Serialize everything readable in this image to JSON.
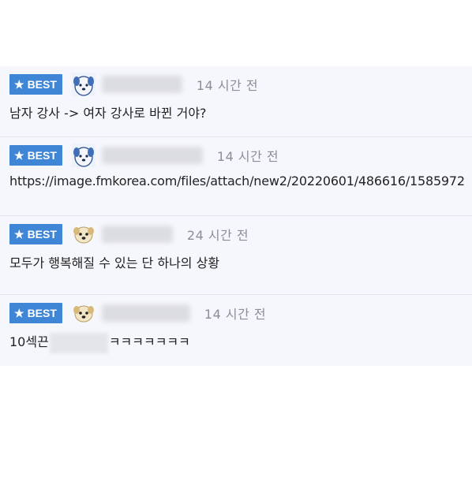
{
  "badge_label": "BEST",
  "comments": [
    {
      "avatar": "dog-white-icon",
      "time": "14 시간 전",
      "text": "남자 강사 -> 여자 강사로 바뀐 거야?"
    },
    {
      "avatar": "dog-white-icon",
      "time": "14 시간 전",
      "text": "https://image.fmkorea.com/files/attach/new2/20220601/486616/1585972"
    },
    {
      "avatar": "puppy-icon",
      "time": "24 시간 전",
      "text": "모두가 행복해질 수 있는 단 하나의 상황"
    },
    {
      "avatar": "puppy-icon",
      "time": "14 시간 전",
      "text_prefix": "10섹끈",
      "text_suffix": "ㅋㅋㅋㅋㅋㅋㅋ"
    }
  ]
}
